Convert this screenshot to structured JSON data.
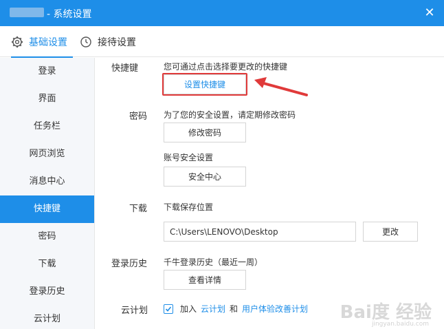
{
  "window": {
    "title": "- 系统设置",
    "close_glyph": "✕"
  },
  "tabs": [
    {
      "label": "基础设置",
      "icon": "gear-icon",
      "active": true
    },
    {
      "label": "接待设置",
      "icon": "clock-icon",
      "active": false
    }
  ],
  "sidebar": {
    "items": [
      {
        "label": "登录"
      },
      {
        "label": "界面"
      },
      {
        "label": "任务栏"
      },
      {
        "label": "网页浏览"
      },
      {
        "label": "消息中心"
      },
      {
        "label": "快捷键",
        "active": true
      },
      {
        "label": "密码"
      },
      {
        "label": "下载"
      },
      {
        "label": "登录历史"
      },
      {
        "label": "云计划"
      }
    ]
  },
  "sections": {
    "hotkey": {
      "label": "快捷键",
      "desc": "您可通过点击选择要更改的快捷键",
      "button": "设置快捷键"
    },
    "password": {
      "label": "密码",
      "desc": "为了您的安全设置，请定期修改密码",
      "button": "修改密码",
      "account_desc": "账号安全设置",
      "account_button": "安全中心"
    },
    "download": {
      "label": "下载",
      "desc": "下载保存位置",
      "path": "C:\\Users\\LENOVO\\Desktop",
      "button": "更改"
    },
    "history": {
      "label": "登录历史",
      "desc": "千牛登录历史（最近一周）",
      "button": "查看详情"
    },
    "cloud": {
      "label": "云计划",
      "checked": true,
      "text_join": "加入",
      "link1": "云计划",
      "text_and": "和",
      "link2": "用户体验改善计划"
    }
  },
  "watermark": {
    "main": "Bai度 经验",
    "sub": "jingyan.baidu.com"
  },
  "colors": {
    "accent": "#1e8ee8",
    "highlight": "#e03a3a"
  }
}
